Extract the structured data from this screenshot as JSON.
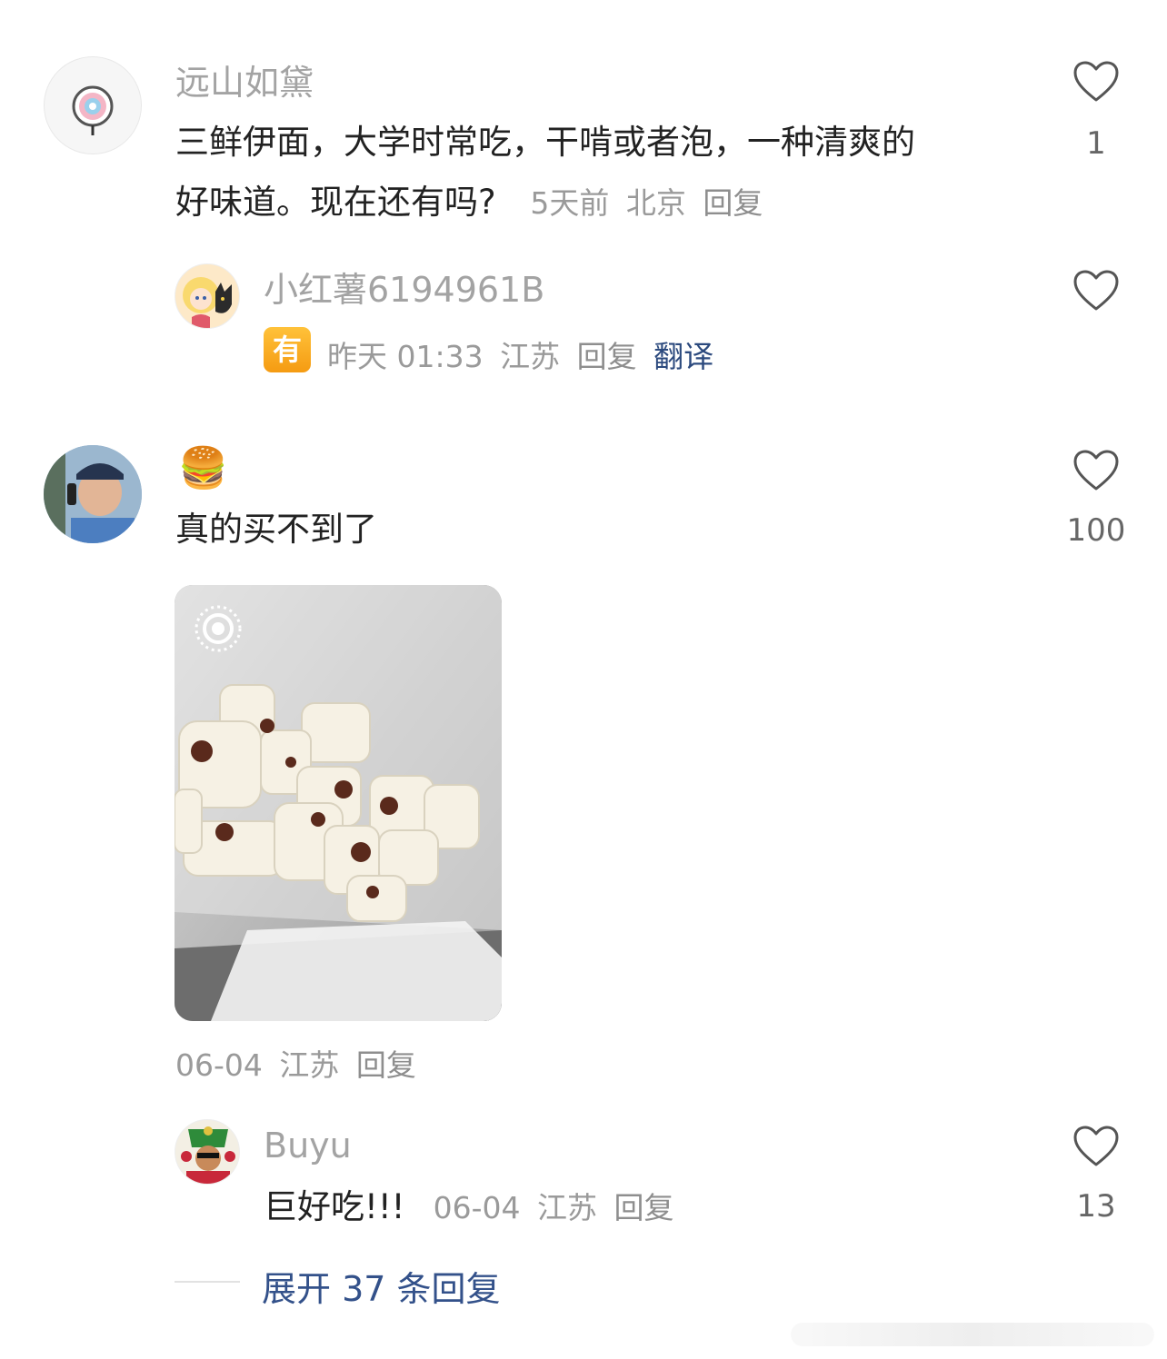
{
  "comments": [
    {
      "username": "远山如黛",
      "text_line1": "三鲜伊面，大学时常吃，干啃或者泡，一种清爽的",
      "text_line2": "好味道。现在还有吗?",
      "time": "5天前",
      "location": "北京",
      "reply_label": "回复",
      "likes": "1",
      "replies": [
        {
          "username": "小红薯6194961B",
          "emoji_badge": "有",
          "time": "昨天 01:33",
          "location": "江苏",
          "reply_label": "回复",
          "translate_label": "翻译"
        }
      ]
    },
    {
      "username_emoji": "🍔",
      "text": "真的买不到了",
      "date": "06-04",
      "location": "江苏",
      "reply_label": "回复",
      "likes": "100",
      "replies": [
        {
          "username": "Buyu",
          "text": "巨好吃!!!",
          "date": "06-04",
          "location": "江苏",
          "reply_label": "回复",
          "likes": "13"
        }
      ],
      "expand_label": "展开 37 条回复"
    }
  ],
  "colors": {
    "username": "#a3a3a3",
    "meta": "#9a9a9a",
    "link": "#33518a",
    "badge": "#f5a623"
  }
}
